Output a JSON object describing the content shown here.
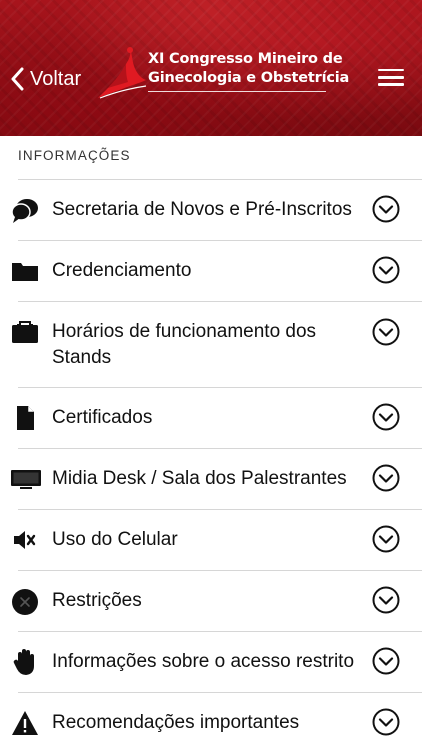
{
  "header": {
    "back_label": "Voltar",
    "title_line1": "XI Congresso Mineiro de",
    "title_line2": "Ginecologia e Obstetrícia",
    "accent_color": "#9b1018"
  },
  "section": {
    "title": "INFORMAÇÕES"
  },
  "items": [
    {
      "label": "Secretaria de Novos e Pré-Inscritos",
      "icon": "chat-bubbles-icon"
    },
    {
      "label": "Credenciamento",
      "icon": "folder-icon"
    },
    {
      "label": "Horários de funcionamento dos Stands",
      "icon": "briefcase-icon"
    },
    {
      "label": "Certificados",
      "icon": "document-icon"
    },
    {
      "label": "Midia Desk / Sala dos Palestrantes",
      "icon": "monitor-icon"
    },
    {
      "label": "Uso do Celular",
      "icon": "speaker-mute-icon"
    },
    {
      "label": "Restrições",
      "icon": "x-circle-icon"
    },
    {
      "label": "Informações sobre o acesso restrito",
      "icon": "hand-icon"
    },
    {
      "label": "Recomendações importantes",
      "icon": "warning-icon"
    }
  ]
}
